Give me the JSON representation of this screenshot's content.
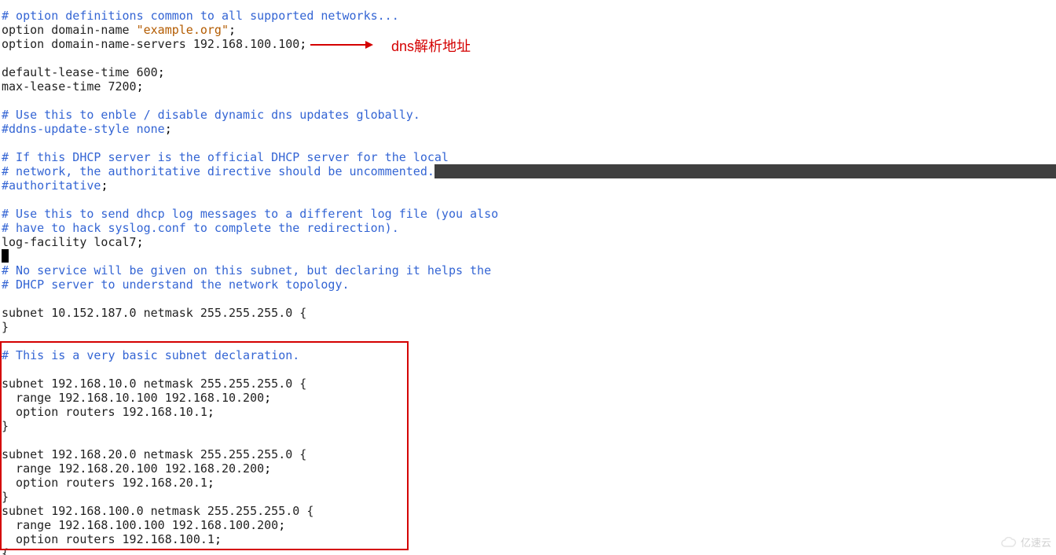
{
  "lines": [
    {
      "segs": [
        {
          "cls": "comment",
          "t": "# option definitions common to all supported networks..."
        }
      ]
    },
    {
      "segs": [
        {
          "cls": "plain",
          "t": "option domain-name "
        },
        {
          "cls": "string",
          "t": "\"example.org\""
        },
        {
          "cls": "semi",
          "t": ";"
        }
      ]
    },
    {
      "segs": [
        {
          "cls": "plain",
          "t": "option domain-name-servers 192.168.100.100"
        },
        {
          "cls": "semi",
          "t": ";"
        }
      ]
    },
    {
      "segs": [
        {
          "cls": "plain",
          "t": ""
        }
      ]
    },
    {
      "segs": [
        {
          "cls": "plain",
          "t": "default-lease-time 600"
        },
        {
          "cls": "semi",
          "t": ";"
        }
      ]
    },
    {
      "segs": [
        {
          "cls": "plain",
          "t": "max-lease-time 7200"
        },
        {
          "cls": "semi",
          "t": ";"
        }
      ]
    },
    {
      "segs": [
        {
          "cls": "plain",
          "t": ""
        }
      ]
    },
    {
      "segs": [
        {
          "cls": "comment",
          "t": "# Use this to enble / disable dynamic dns updates globally."
        }
      ]
    },
    {
      "segs": [
        {
          "cls": "comment",
          "t": "#ddns-update-style none"
        },
        {
          "cls": "semi",
          "t": ";"
        }
      ]
    },
    {
      "segs": [
        {
          "cls": "plain",
          "t": ""
        }
      ]
    },
    {
      "segs": [
        {
          "cls": "comment",
          "t": "# If this DHCP server is the official DHCP server for the local"
        }
      ]
    },
    {
      "hl": true,
      "segs": [
        {
          "cls": "comment",
          "t": "# network, the authoritative directive should be uncommented."
        }
      ]
    },
    {
      "segs": [
        {
          "cls": "comment",
          "t": "#authoritative"
        },
        {
          "cls": "semi",
          "t": ";"
        }
      ]
    },
    {
      "segs": [
        {
          "cls": "plain",
          "t": ""
        }
      ]
    },
    {
      "segs": [
        {
          "cls": "comment",
          "t": "# Use this to send dhcp log messages to a different log file (you also"
        }
      ]
    },
    {
      "segs": [
        {
          "cls": "comment",
          "t": "# have to hack syslog.conf to complete the redirection)."
        }
      ]
    },
    {
      "segs": [
        {
          "cls": "plain",
          "t": "log-facility local7"
        },
        {
          "cls": "semi",
          "t": ";"
        }
      ]
    },
    {
      "cursor": true,
      "segs": []
    },
    {
      "segs": [
        {
          "cls": "comment",
          "t": "# No service will be given on this subnet, but declaring it helps the"
        }
      ]
    },
    {
      "segs": [
        {
          "cls": "comment",
          "t": "# DHCP server to understand the network topology."
        }
      ]
    },
    {
      "segs": [
        {
          "cls": "plain",
          "t": ""
        }
      ]
    },
    {
      "segs": [
        {
          "cls": "plain",
          "t": "subnet 10.152.187.0 netmask 255.255.255.0 {"
        }
      ]
    },
    {
      "segs": [
        {
          "cls": "plain",
          "t": "}"
        }
      ]
    },
    {
      "segs": [
        {
          "cls": "plain",
          "t": ""
        }
      ]
    },
    {
      "segs": [
        {
          "cls": "comment",
          "t": "# This is a very basic subnet declaration."
        }
      ]
    },
    {
      "segs": [
        {
          "cls": "plain",
          "t": ""
        }
      ]
    },
    {
      "segs": [
        {
          "cls": "plain",
          "t": "subnet 192.168.10.0 netmask 255.255.255.0 {"
        }
      ]
    },
    {
      "segs": [
        {
          "cls": "plain",
          "t": "  range 192.168.10.100 192.168.10.200"
        },
        {
          "cls": "semi",
          "t": ";"
        }
      ]
    },
    {
      "segs": [
        {
          "cls": "plain",
          "t": "  option routers 192.168.10.1"
        },
        {
          "cls": "semi",
          "t": ";"
        }
      ]
    },
    {
      "segs": [
        {
          "cls": "plain",
          "t": "}"
        }
      ]
    },
    {
      "segs": [
        {
          "cls": "plain",
          "t": ""
        }
      ]
    },
    {
      "segs": [
        {
          "cls": "plain",
          "t": "subnet 192.168.20.0 netmask 255.255.255.0 {"
        }
      ]
    },
    {
      "segs": [
        {
          "cls": "plain",
          "t": "  range 192.168.20.100 192.168.20.200"
        },
        {
          "cls": "semi",
          "t": ";"
        }
      ]
    },
    {
      "segs": [
        {
          "cls": "plain",
          "t": "  option routers 192.168.20.1"
        },
        {
          "cls": "semi",
          "t": ";"
        }
      ]
    },
    {
      "segs": [
        {
          "cls": "plain",
          "t": "}"
        }
      ]
    },
    {
      "segs": [
        {
          "cls": "plain",
          "t": "subnet 192.168.100.0 netmask 255.255.255.0 {"
        }
      ]
    },
    {
      "segs": [
        {
          "cls": "plain",
          "t": "  range 192.168.100.100 192.168.100.200"
        },
        {
          "cls": "semi",
          "t": ";"
        }
      ]
    },
    {
      "segs": [
        {
          "cls": "plain",
          "t": "  option routers 192.168.100.1"
        },
        {
          "cls": "semi",
          "t": ";"
        }
      ]
    },
    {
      "segs": [
        {
          "cls": "plain",
          "t": "{"
        }
      ]
    }
  ],
  "annotation": "dns解析地址",
  "watermark": "亿速云",
  "colors": {
    "comment": "#3465d4",
    "string": "#b35b00",
    "annotation": "#d40000",
    "highlight_bg": "#3f3f3f"
  }
}
